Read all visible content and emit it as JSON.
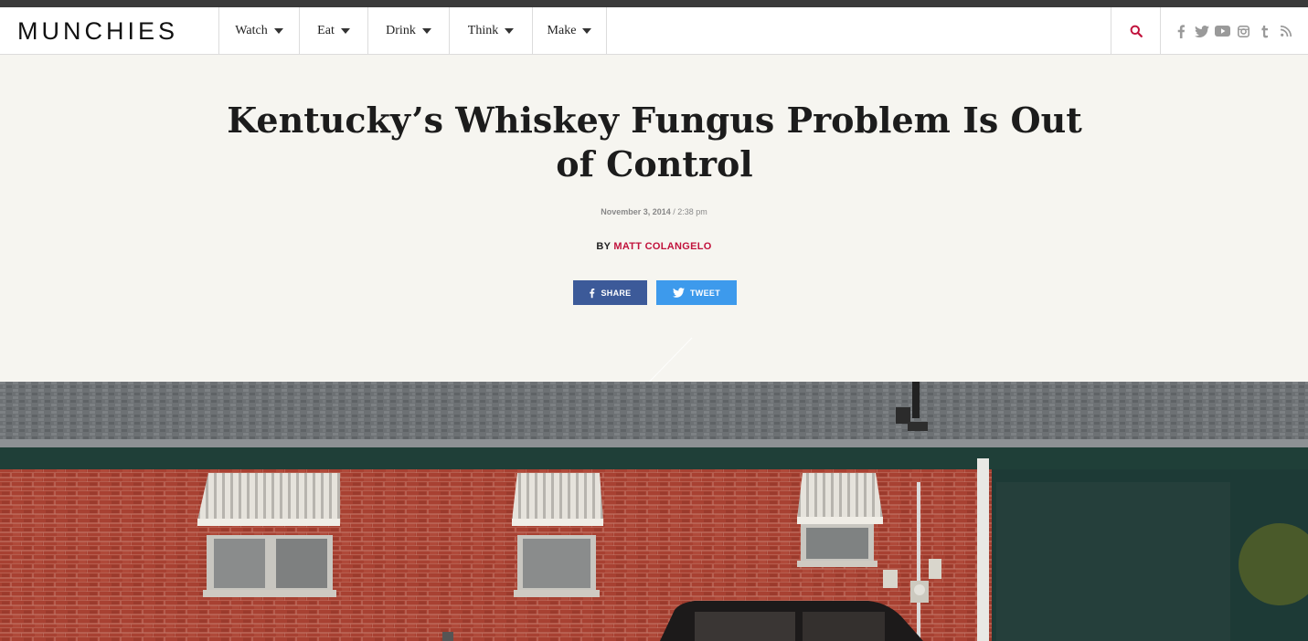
{
  "brand": {
    "logo": "MUNCHIES"
  },
  "nav": {
    "items": [
      {
        "label": "Watch"
      },
      {
        "label": "Eat"
      },
      {
        "label": "Drink"
      },
      {
        "label": "Think"
      },
      {
        "label": "Make"
      }
    ]
  },
  "social_icons": [
    "facebook-icon",
    "twitter-icon",
    "youtube-icon",
    "instagram-icon",
    "tumblr-icon",
    "rss-icon"
  ],
  "article": {
    "title": "Kentucky’s Whiskey Fungus Problem Is Out of Control",
    "date": "November 3, 2014",
    "time": "/ 2:38 pm",
    "by_prefix": "BY",
    "author": "MATT COLANGELO"
  },
  "share": {
    "share_label": "SHARE",
    "tweet_label": "TWEET"
  },
  "colors": {
    "accent": "#c1123c",
    "facebook": "#3c5a99",
    "twitter": "#3d9aec",
    "background": "#f6f5f0"
  }
}
